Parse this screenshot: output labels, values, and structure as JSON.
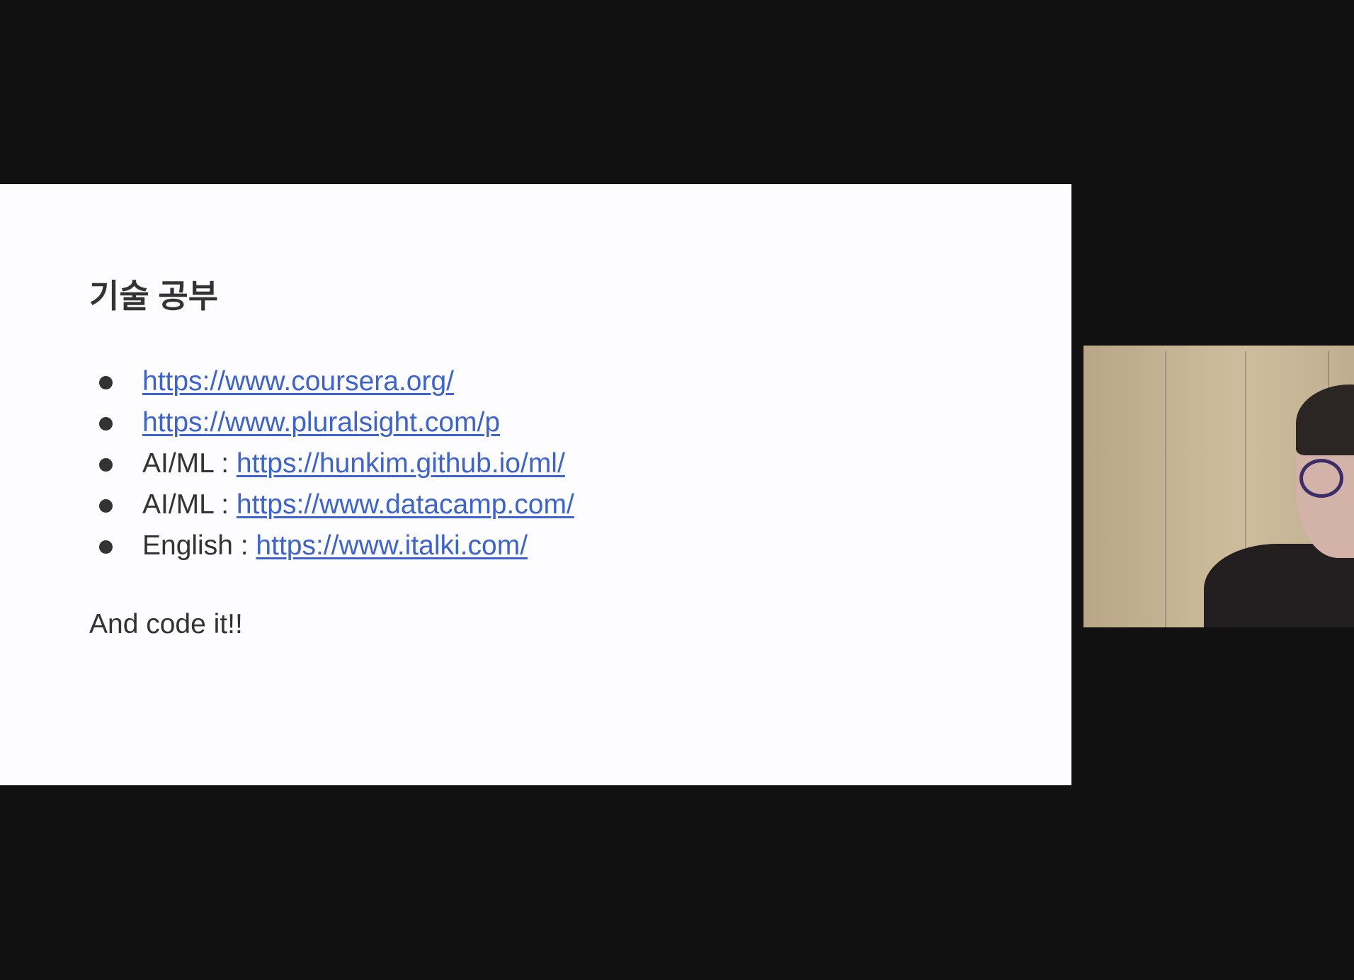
{
  "slide": {
    "title": "기술 공부",
    "items": [
      {
        "prefix": "",
        "link": "https://www.coursera.org/"
      },
      {
        "prefix": "",
        "link": "https://www.pluralsight.com/p"
      },
      {
        "prefix": "AI/ML : ",
        "link": "https://hunkim.github.io/ml/"
      },
      {
        "prefix": "AI/ML : ",
        "link": "https://www.datacamp.com/"
      },
      {
        "prefix": "English : ",
        "link": "https://www.italki.com/"
      }
    ],
    "footer": "And code it!!"
  },
  "colors": {
    "link": "#3b63d4",
    "text": "#333333",
    "background": "#111111"
  }
}
